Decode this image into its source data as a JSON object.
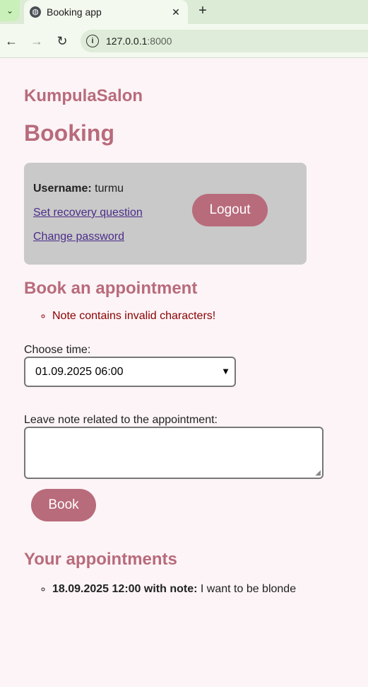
{
  "browser": {
    "tab_title": "Booking app",
    "url_host": "127.0.0.1",
    "url_port": ":8000"
  },
  "page": {
    "brand": "KumpulaSalon",
    "title": "Booking"
  },
  "user_card": {
    "username_label": "Username:",
    "username": "turmu",
    "recovery_link": "Set recovery question",
    "password_link": "Change password",
    "logout_label": "Logout"
  },
  "booking": {
    "heading": "Book an appointment",
    "errors": [
      "Note contains invalid characters!"
    ],
    "time_label": "Choose time:",
    "time_selected": "01.09.2025 06:00",
    "note_label": "Leave note related to the appointment:",
    "note_value": "",
    "book_label": "Book"
  },
  "appointments": {
    "heading": "Your appointments",
    "items": [
      {
        "when": "18.09.2025 12:00 with note:",
        "note": "I want to be blonde"
      }
    ]
  }
}
